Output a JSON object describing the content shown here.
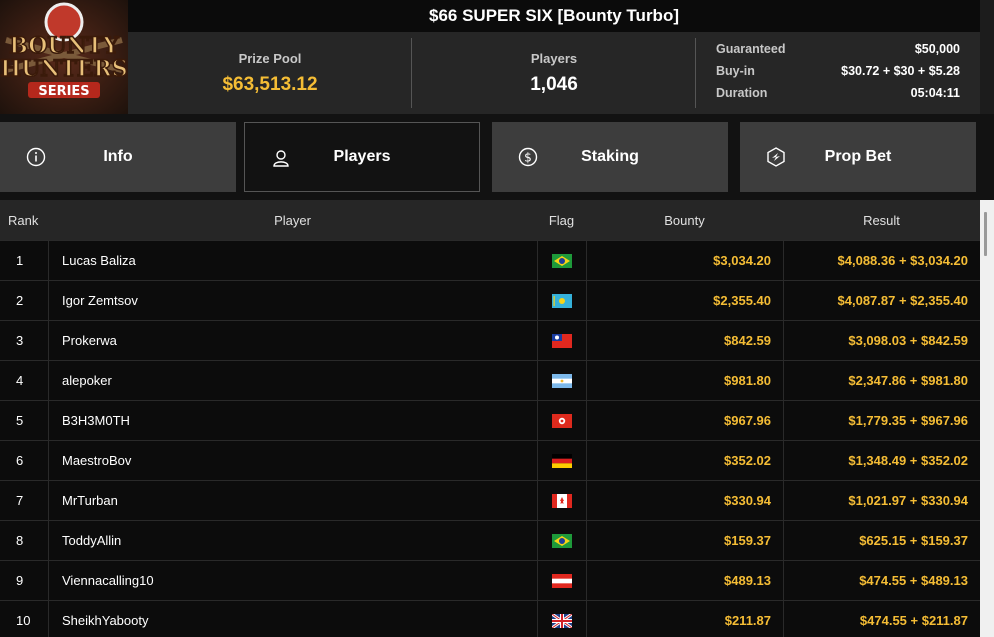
{
  "logo": {
    "line1": "BOUNTY",
    "line2": "HUNTERS",
    "line3": "SERIES"
  },
  "title": "$66 SUPER SIX [Bounty Turbo]",
  "stats": {
    "prize_pool_label": "Prize Pool",
    "prize_pool_value": "$63,513.12",
    "players_label": "Players",
    "players_value": "1,046",
    "guaranteed_label": "Guaranteed",
    "guaranteed_value": "$50,000",
    "buyin_label": "Buy-in",
    "buyin_value": "$30.72 + $30 + $5.28",
    "duration_label": "Duration",
    "duration_value": "05:04:11"
  },
  "tabs": [
    {
      "label": "Info",
      "icon": "info-icon",
      "active": false
    },
    {
      "label": "Players",
      "icon": "user-icon",
      "active": true
    },
    {
      "label": "Staking",
      "icon": "dollar-icon",
      "active": false
    },
    {
      "label": "Prop Bet",
      "icon": "hexagon-bolt-icon",
      "active": false
    }
  ],
  "table": {
    "headers": {
      "rank": "Rank",
      "player": "Player",
      "flag": "Flag",
      "bounty": "Bounty",
      "result": "Result"
    },
    "rows": [
      {
        "rank": "1",
        "player": "Lucas Baliza",
        "flag": "brazil",
        "bounty": "$3,034.20",
        "result": "$4,088.36 + $3,034.20"
      },
      {
        "rank": "2",
        "player": "Igor Zemtsov",
        "flag": "kazakhstan",
        "bounty": "$2,355.40",
        "result": "$4,087.87 + $2,355.40"
      },
      {
        "rank": "3",
        "player": "Prokerwa",
        "flag": "taiwan",
        "bounty": "$842.59",
        "result": "$3,098.03 + $842.59"
      },
      {
        "rank": "4",
        "player": "alepoker",
        "flag": "argentina",
        "bounty": "$981.80",
        "result": "$2,347.86 + $981.80"
      },
      {
        "rank": "5",
        "player": "B3H3M0TH",
        "flag": "hong-kong",
        "bounty": "$967.96",
        "result": "$1,779.35 + $967.96"
      },
      {
        "rank": "6",
        "player": "MaestroBov",
        "flag": "germany",
        "bounty": "$352.02",
        "result": "$1,348.49 + $352.02"
      },
      {
        "rank": "7",
        "player": "MrTurban",
        "flag": "canada",
        "bounty": "$330.94",
        "result": "$1,021.97 + $330.94"
      },
      {
        "rank": "8",
        "player": "ToddyAllin",
        "flag": "brazil",
        "bounty": "$159.37",
        "result": "$625.15 + $159.37"
      },
      {
        "rank": "9",
        "player": "Viennacalling10",
        "flag": "austria",
        "bounty": "$489.13",
        "result": "$474.55 + $489.13"
      },
      {
        "rank": "10",
        "player": "SheikhYabooty",
        "flag": "united-kingdom",
        "bounty": "$211.87",
        "result": "$474.55 + $211.87"
      }
    ]
  },
  "colors": {
    "gold": "#f5bd35",
    "tab_inactive": "#3d3d3d",
    "row_bg": "#0c0c0c"
  }
}
